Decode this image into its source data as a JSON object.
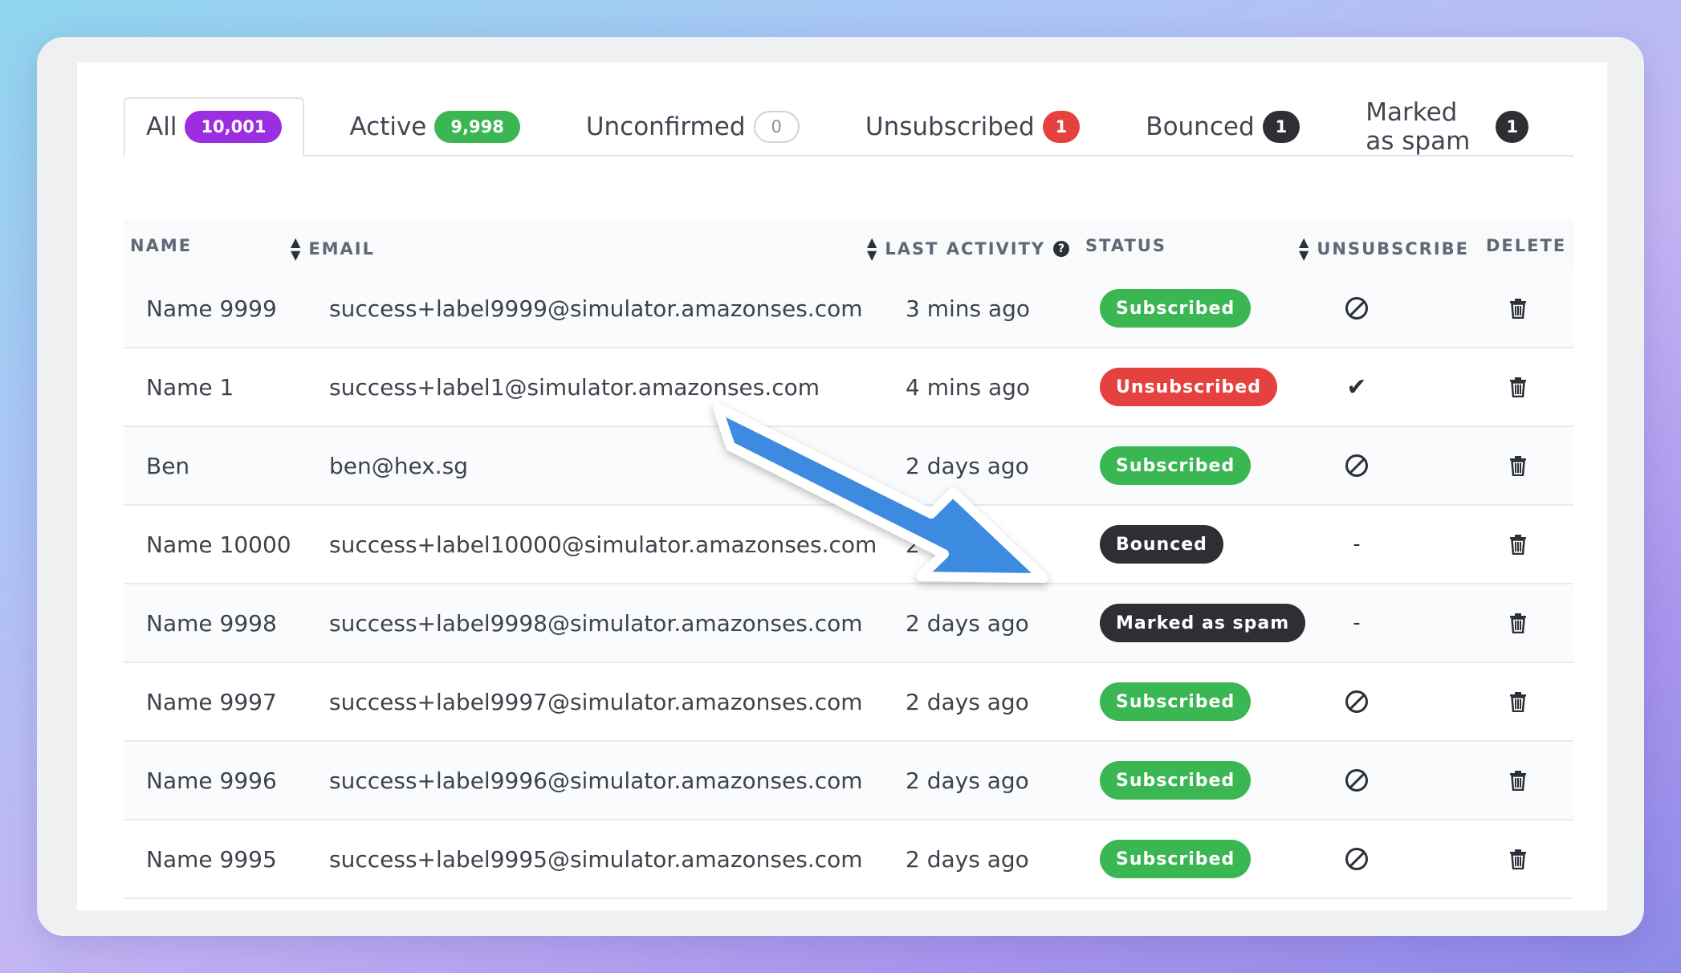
{
  "tabs": [
    {
      "label": "All",
      "count": "10,001",
      "color": "#9b2ee0",
      "active": true
    },
    {
      "label": "Active",
      "count": "9,998",
      "color": "#3ab653"
    },
    {
      "label": "Unconfirmed",
      "count": "0",
      "color": "#ffffff"
    },
    {
      "label": "Unsubscribed",
      "count": "1",
      "color": "#e5423f"
    },
    {
      "label": "Bounced",
      "count": "1",
      "color": "#2d2f33"
    },
    {
      "label": "Marked as spam",
      "count": "1",
      "color": "#2d2f33"
    }
  ],
  "table": {
    "headers": {
      "name": "NAME",
      "email": "EMAIL",
      "last_activity": "LAST ACTIVITY",
      "status": "STATUS",
      "unsubscribe": "UNSUBSCRIBE",
      "delete": "DELETE"
    },
    "rows": [
      {
        "name": "Name 9999",
        "email": "success+label9999@simulator.amazonses.com",
        "last_activity": "3 mins ago",
        "status": "Subscribed",
        "unsubscribe": "ban-icon"
      },
      {
        "name": "Name 1",
        "email": "success+label1@simulator.amazonses.com",
        "last_activity": "4 mins ago",
        "status": "Unsubscribed",
        "unsubscribe": "check-icon"
      },
      {
        "name": "Ben",
        "email": "ben@hex.sg",
        "last_activity": "2 days ago",
        "status": "Subscribed",
        "unsubscribe": "ban-icon"
      },
      {
        "name": "Name 10000",
        "email": "success+label10000@simulator.amazonses.com",
        "last_activity": "2 d",
        "status": "Bounced",
        "unsubscribe": "-"
      },
      {
        "name": "Name 9998",
        "email": "success+label9998@simulator.amazonses.com",
        "last_activity": "2 days ago",
        "status": "Marked as spam",
        "unsubscribe": "-"
      },
      {
        "name": "Name 9997",
        "email": "success+label9997@simulator.amazonses.com",
        "last_activity": "2 days ago",
        "status": "Subscribed",
        "unsubscribe": "ban-icon"
      },
      {
        "name": "Name 9996",
        "email": "success+label9996@simulator.amazonses.com",
        "last_activity": "2 days ago",
        "status": "Subscribed",
        "unsubscribe": "ban-icon"
      },
      {
        "name": "Name 9995",
        "email": "success+label9995@simulator.amazonses.com",
        "last_activity": "2 days ago",
        "status": "Subscribed",
        "unsubscribe": "ban-icon"
      }
    ]
  },
  "colors": {
    "subscribed": "#3ab653",
    "unsubscribed": "#e5423f",
    "bounced": "#2d2f33",
    "arrow": "#3d8be0"
  },
  "annotation": {
    "icon": "arrow-annotation-icon"
  }
}
